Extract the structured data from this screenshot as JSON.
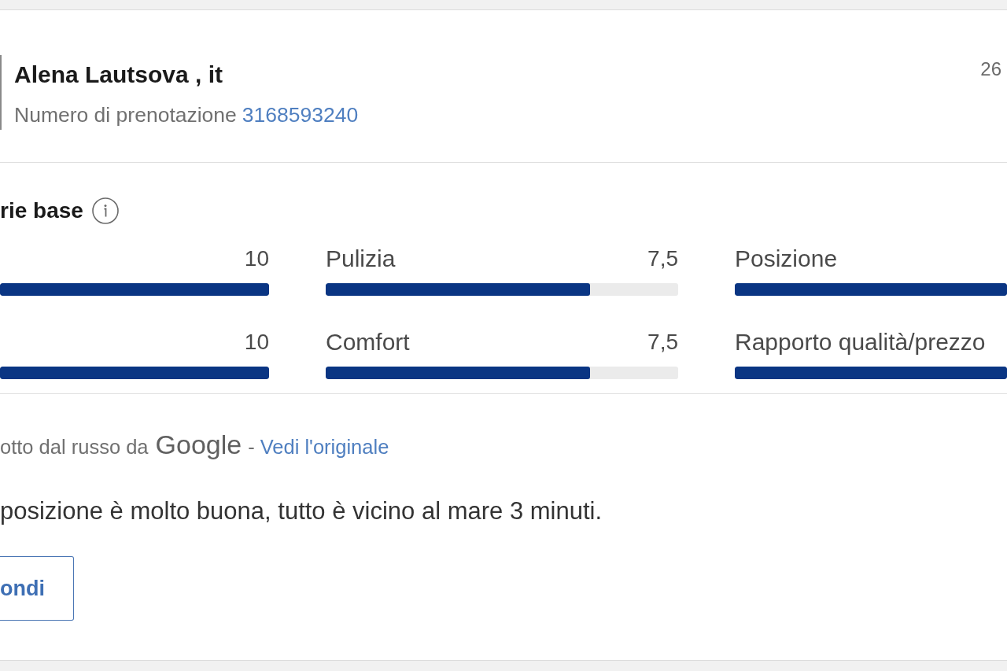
{
  "review": {
    "guest": {
      "name": "Alena Lautsova , it",
      "booking_label": "Numero di prenotazione",
      "booking_number": "3168593240"
    },
    "date": "26",
    "scores": {
      "title": "rie base",
      "categories": [
        {
          "score": "10",
          "level": 1
        },
        {
          "label": "Pulizia",
          "score": "7,5",
          "level": 0.75
        },
        {
          "label": "Posizione",
          "level": 1
        },
        {
          "score": "10",
          "level": 1
        },
        {
          "label": "Comfort",
          "score": "7,5",
          "level": 0.75
        },
        {
          "label": "Rapporto qualità/prezzo",
          "level": 1
        }
      ]
    },
    "translation": {
      "note": "otto dal russo da",
      "provider": "Google",
      "separator": "-",
      "link": "Vedi l'originale"
    },
    "text": "posizione è molto buona, tutto è vicino al mare 3 minuti.",
    "reply_button": "ondi"
  }
}
